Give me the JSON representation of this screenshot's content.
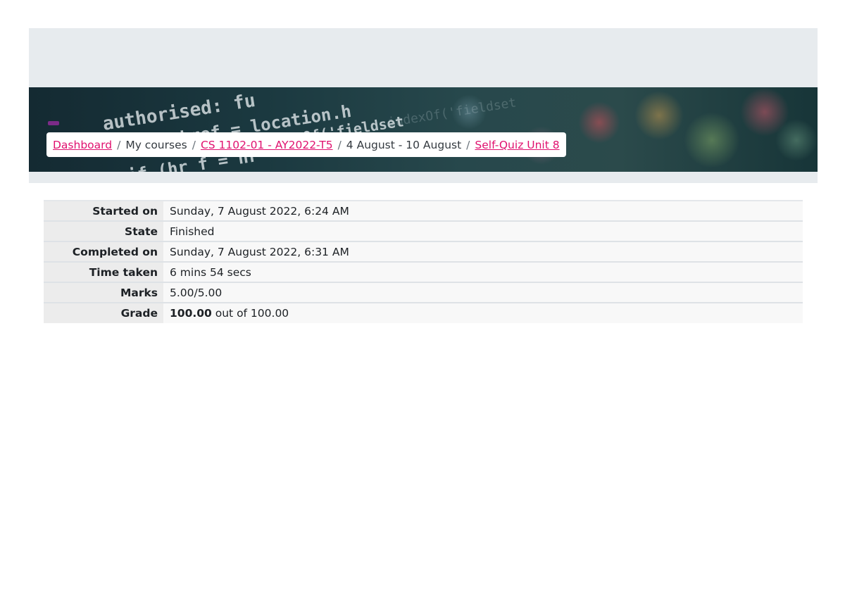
{
  "header": {
    "banner_code_lines": [
      "authorised: fu",
      "href = location.h",
      "indexOf('fieldset",
      "if (hr   f = hr"
    ]
  },
  "breadcrumb": {
    "items": [
      {
        "label": "Dashboard",
        "link": true
      },
      {
        "label": "My courses",
        "link": false
      },
      {
        "label": "CS 1102-01 - AY2022-T5",
        "link": true
      },
      {
        "label": "4 August - 10 August",
        "link": false
      },
      {
        "label": "Self-Quiz Unit 8",
        "link": true
      }
    ],
    "separator": "/"
  },
  "summary": {
    "rows": [
      {
        "label": "Started on",
        "value": "Sunday, 7 August 2022, 6:24 AM"
      },
      {
        "label": "State",
        "value": "Finished"
      },
      {
        "label": "Completed on",
        "value": "Sunday, 7 August 2022, 6:31 AM"
      },
      {
        "label": "Time taken",
        "value": "6 mins 54 secs"
      },
      {
        "label": "Marks",
        "value": "5.00/5.00"
      },
      {
        "label": "Grade",
        "value_strong": "100.00",
        "value_rest": " out of 100.00"
      }
    ]
  },
  "colors": {
    "link": "#e0116f",
    "band": "#e7ebee",
    "banner_dark": "#1b3940"
  }
}
